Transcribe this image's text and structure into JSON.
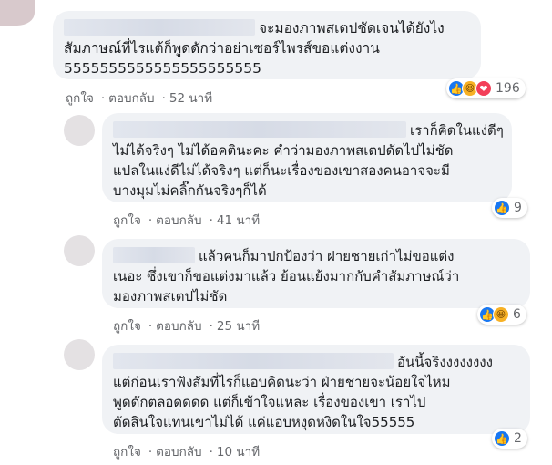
{
  "comments": [
    {
      "text_line1": "จะมองภาพสเตปชัดเจนได้ยังไง",
      "text_line2": "สัมภาษณ์ที่ไรแต้ก็พูดดักว่าอย่าเซอร์ไพรส์ขอแต่งงาน",
      "text_line3": "5555555555555555555555",
      "like": "ถูกใจ",
      "reply": "ตอบกลับ",
      "time": "52 นาที",
      "reaction_icons": [
        "like-icon",
        "haha-icon",
        "love-icon"
      ],
      "reaction_count": "196"
    },
    {
      "text_line1": "เราก็คิดในแง่ดีๆ",
      "text_line2": "ไม่ได้จริงๆ ไม่ได้อคตินะคะ คำว่ามองภาพสเตปดัดไปไม่ชัด",
      "text_line3": "แปลในแง่ดีไม่ได้จริงๆ แต่ก็นะเรื่องของเขาสองคนอาจจะมี",
      "text_line4": "บางมุมไม่คลิ๊กกันจริงๆก็ได้",
      "like": "ถูกใจ",
      "reply": "ตอบกลับ",
      "time": "41 นาที",
      "reaction_icons": [
        "like-icon"
      ],
      "reaction_count": "9"
    },
    {
      "text_line1": "แล้วคนก็มาปกป้องว่า ฝ่ายชายเก่าไม่ขอแต่ง",
      "text_line2": "เนอะ ซึ่งเขาก็ขอแต่งมาแล้ว ย้อนแย้งมากกับคำสัมภาษณ์ว่า",
      "text_line3": "มองภาพสเตปไม่ชัด",
      "like": "ถูกใจ",
      "reply": "ตอบกลับ",
      "time": "25 นาที",
      "reaction_icons": [
        "like-icon",
        "haha-icon"
      ],
      "reaction_count": "6"
    },
    {
      "text_line1": "อันนี้จริงงงงงงงง",
      "text_line2": "แต่ก่อนเราฟังสัมที่ไรก็แอบคิดนะว่า ฝ่ายชายจะน้อยใจไหม",
      "text_line3": "พูดดักตลอดดดด แต่ก็เข้าใจแหละ เรื่องของเขา เราไป",
      "text_line4": "ตัดสินใจแทนเขาไม่ได้ แค่แอบหงุดหงิดในใจ55555",
      "like": "ถูกใจ",
      "reply": "ตอบกลับ",
      "time": "10 นาที",
      "reaction_icons": [
        "like-icon"
      ],
      "reaction_count": "2"
    }
  ],
  "separator": "·",
  "colors": {
    "bubble": "#f0f2f5",
    "meta_text": "#65676b",
    "like": "#1877f2",
    "haha": "#f7b125",
    "love": "#f33e58"
  }
}
